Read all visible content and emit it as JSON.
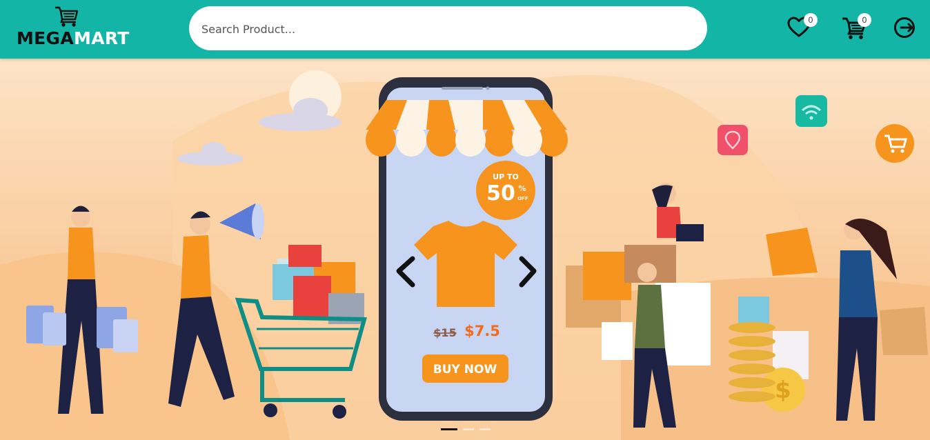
{
  "header": {
    "logo": {
      "part1": "MEGA",
      "part2": "MART",
      "icon": "shopping-cart-icon"
    },
    "search": {
      "placeholder": "Search Product..."
    },
    "wishlist": {
      "icon": "heart-icon",
      "count": "0"
    },
    "cart": {
      "icon": "cart-icon",
      "count": "0"
    },
    "logout": {
      "icon": "logout-icon"
    }
  },
  "banner": {
    "phone": {
      "discount_line1": "UP TO",
      "discount_value": "50",
      "discount_unit": "%",
      "discount_off": "OFF",
      "old_price": "$15",
      "new_price": "$7.5",
      "cta": "BUY NOW"
    },
    "carousel": {
      "slides": 3,
      "active": 1
    }
  },
  "colors": {
    "primary": "#12b5a6",
    "banner_bg": "#f7c48e",
    "accent": "#f7941d"
  }
}
